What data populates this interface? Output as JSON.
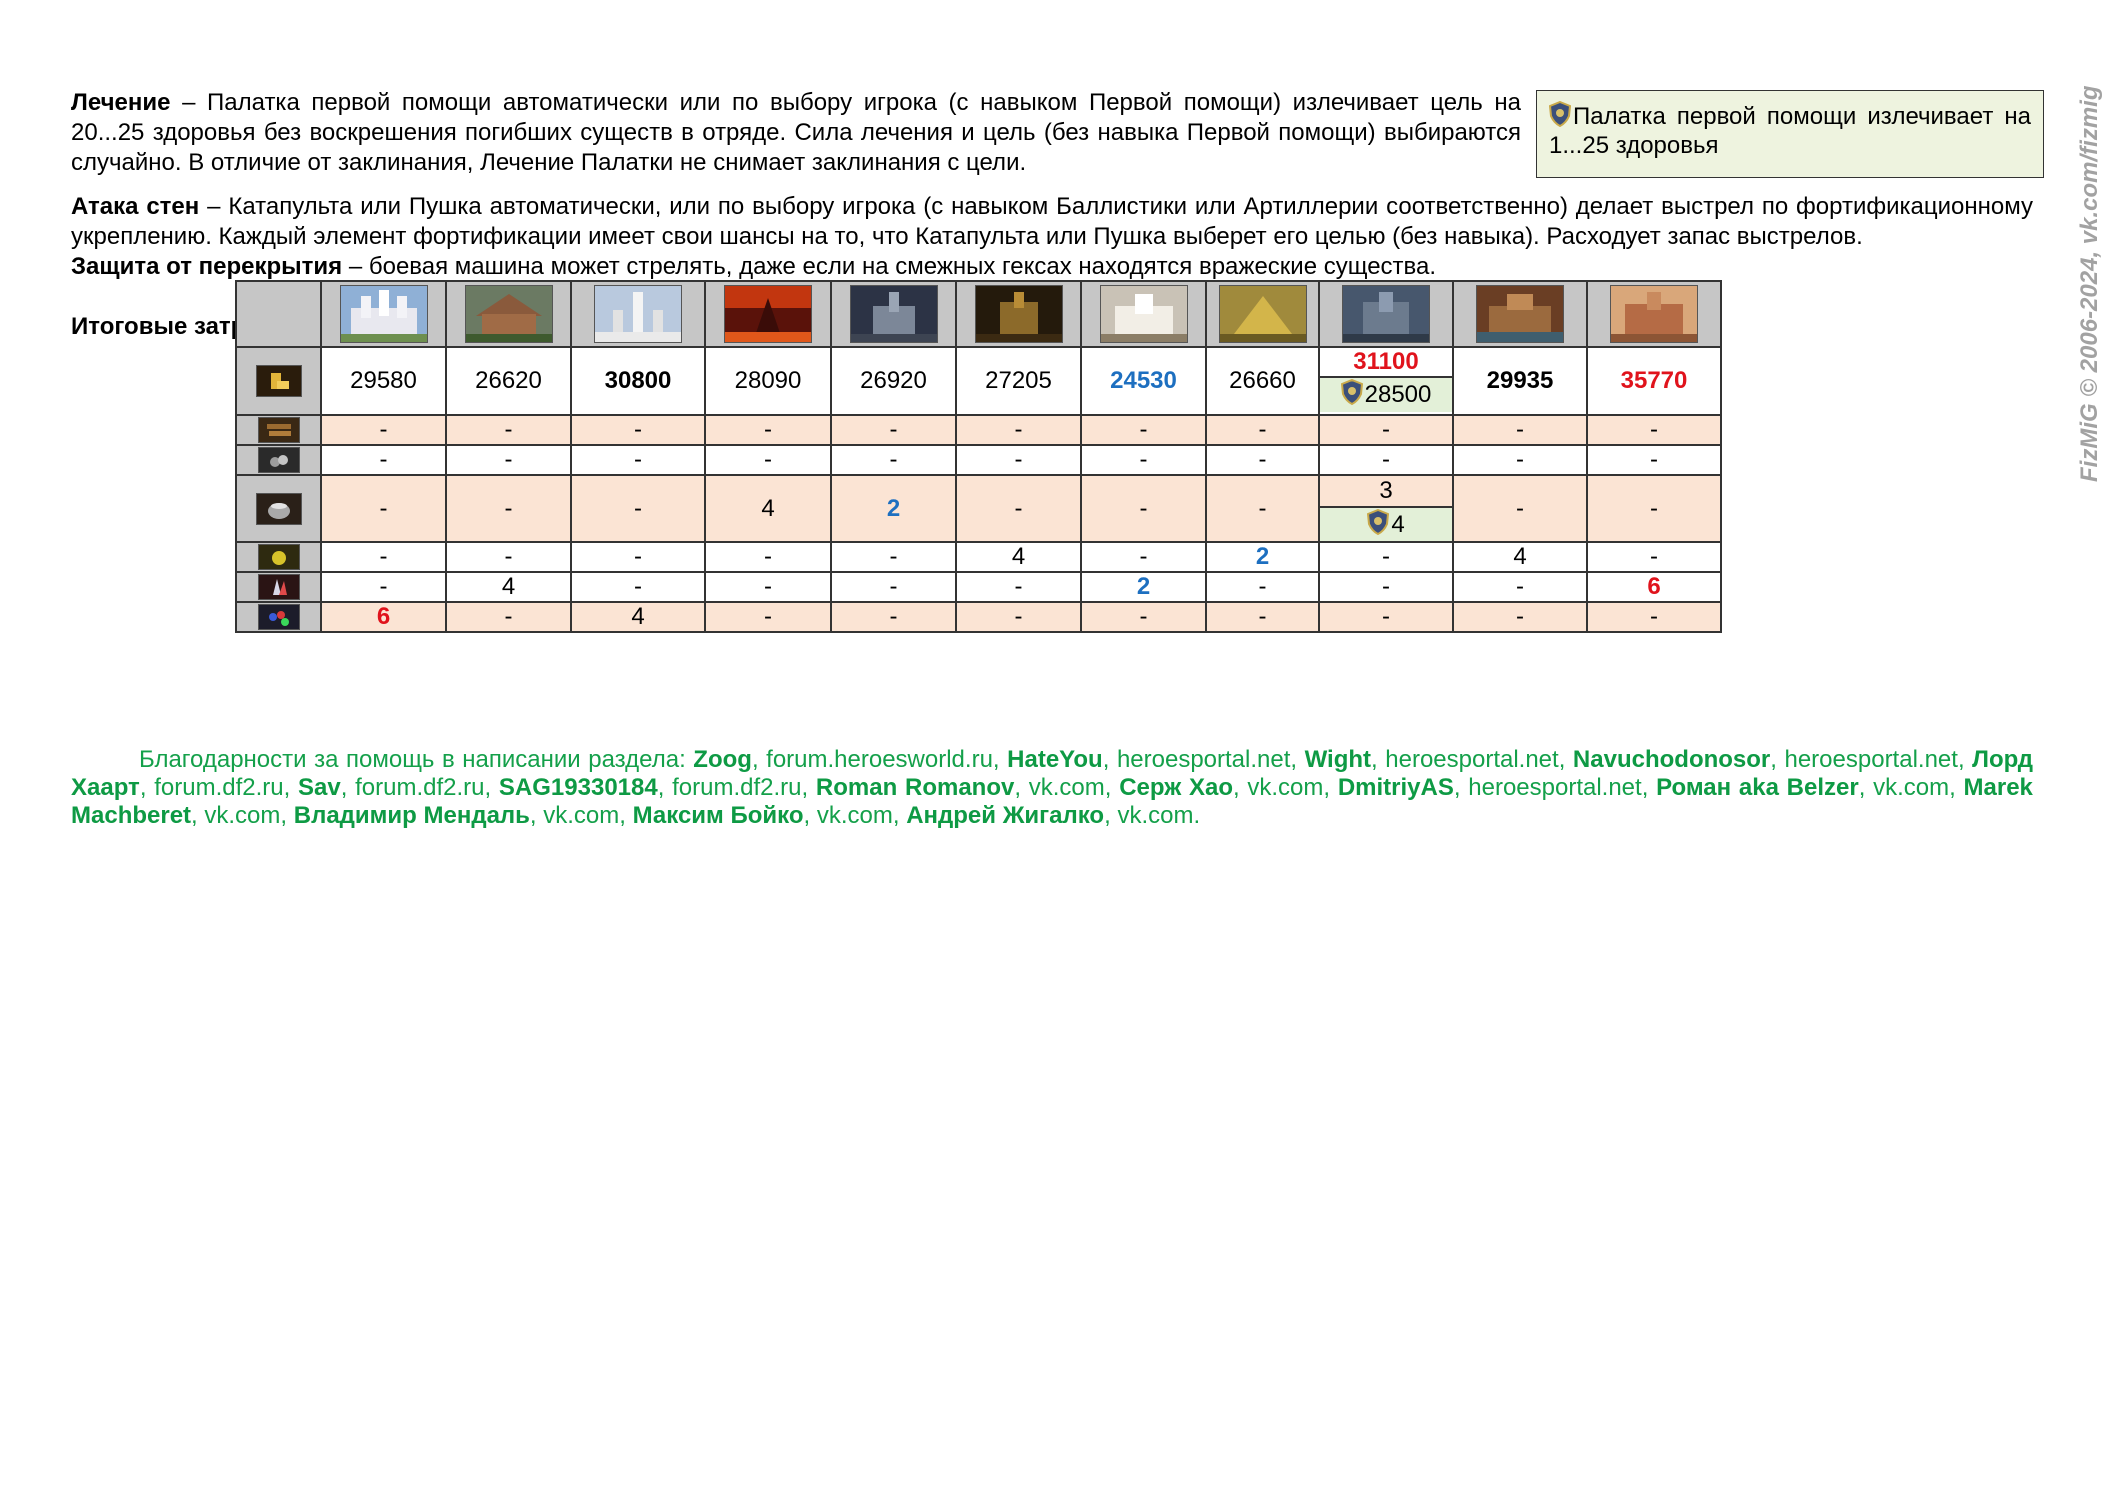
{
  "healing": {
    "term": "Лечение",
    "text": " – Палатка первой помощи автоматически или по выбору игрока (с навыком Первой помощи) излечивает цель на 20...25 здоровья без воскрешения погибших существ в отряде. Сила лечения и цель (без навыка Первой помощи) выбираются случайно. В отличие от заклинания, Лечение Палатки не снимает заклинания с цели."
  },
  "note_box": {
    "text": "Палатка первой помощи излечивает на 1...25 здоровья"
  },
  "wall_attack": {
    "term": "Атака стен",
    "text": " – Катапульта или Пушка автоматически, или по выбору игрока (с навыком Баллистики или Артиллерии соответственно) делает выстрел по фортификационному укреплению. Каждый элемент фортификации имеет свои шансы на то, что Катапульта или Пушка выберет его целью (без навыка). Расходует запас выстрелов."
  },
  "overlap_protection": {
    "term": "Защита от перекрытия",
    "text": " – боевая машина может стрелять, даже если на смежных гексах находятся вражеские существа."
  },
  "summary_title": "Итоговые затраты ресурсов на наём недельного прироста полностью отстроенного города, без учёта Грааля и покупки боевых машин:",
  "table": {
    "towns": [
      "castle-town",
      "rampart-town",
      "tower-town",
      "inferno-town",
      "necropolis-town",
      "dungeon-town",
      "stronghold-town",
      "fortress-town",
      "conflux-town",
      "cove-town",
      "factory-town"
    ],
    "rows": {
      "gold": [
        "29580",
        "26620",
        "30800",
        "28090",
        "26920",
        "27205",
        "24530",
        "26660",
        "",
        "29935",
        "35770"
      ],
      "gold_split": {
        "top": "31100",
        "bottom": "28500"
      },
      "wood": [
        "-",
        "-",
        "-",
        "-",
        "-",
        "-",
        "-",
        "-",
        "-",
        "-",
        "-"
      ],
      "ore": [
        "-",
        "-",
        "-",
        "-",
        "-",
        "-",
        "-",
        "-",
        "-",
        "-",
        "-"
      ],
      "mercury": [
        "-",
        "-",
        "-",
        "4",
        "2",
        "-",
        "-",
        "-",
        "",
        "-",
        "-"
      ],
      "mercury_split": {
        "top": "3",
        "bottom": "4"
      },
      "sulfur": [
        "-",
        "-",
        "-",
        "-",
        "-",
        "4",
        "-",
        "2",
        "-",
        "4",
        "-"
      ],
      "crystal": [
        "-",
        "4",
        "-",
        "-",
        "-",
        "-",
        "2",
        "-",
        "-",
        "-",
        "6"
      ],
      "gems": [
        "6",
        "-",
        "4",
        "-",
        "-",
        "-",
        "-",
        "-",
        "-",
        "-",
        "-"
      ]
    },
    "resource_icons": [
      "gold-icon",
      "wood-icon",
      "ore-icon",
      "mercury-icon",
      "sulfur-icon",
      "crystal-icon",
      "gems-icon"
    ]
  },
  "thanks": {
    "intro": "Благодарности за помощь в написании раздела: ",
    "entries": [
      {
        "name": "Zoog",
        "site": "forum.heroesworld.ru"
      },
      {
        "name": "HateYou",
        "site": "heroesportal.net"
      },
      {
        "name": "Wight",
        "site": "heroesportal.net"
      },
      {
        "name": "Navuchodonosor",
        "site": "heroesportal.net"
      },
      {
        "name": "Лорд Хаарт",
        "site": "forum.df2.ru"
      },
      {
        "name": "Sav",
        "site": "forum.df2.ru"
      },
      {
        "name": "SAG19330184",
        "site": "forum.df2.ru"
      },
      {
        "name": "Roman Romanov",
        "site": "vk.com"
      },
      {
        "name": "Серж Хао",
        "site": "vk.com"
      },
      {
        "name": "DmitriyAS",
        "site": "heroesportal.net"
      },
      {
        "name": "Роман aka Belzer",
        "site": "vk.com"
      },
      {
        "name": "Marek Machberet",
        "site": "vk.com"
      },
      {
        "name": "Владимир Мендаль",
        "site": "vk.com"
      },
      {
        "name": "Максим Бойко",
        "site": "vk.com"
      },
      {
        "name": "Андрей Жигалко",
        "site": "vk.com"
      }
    ]
  },
  "watermark": "FizMiG © 2006-2024, vk.com/fizmig",
  "colors": {
    "highlight_blue": "#1d6fc0",
    "highlight_red": "#e0131c",
    "thanks_green": "#14a04a",
    "note_bg": "#eef3df",
    "row_tint": "#fbe4d4"
  }
}
